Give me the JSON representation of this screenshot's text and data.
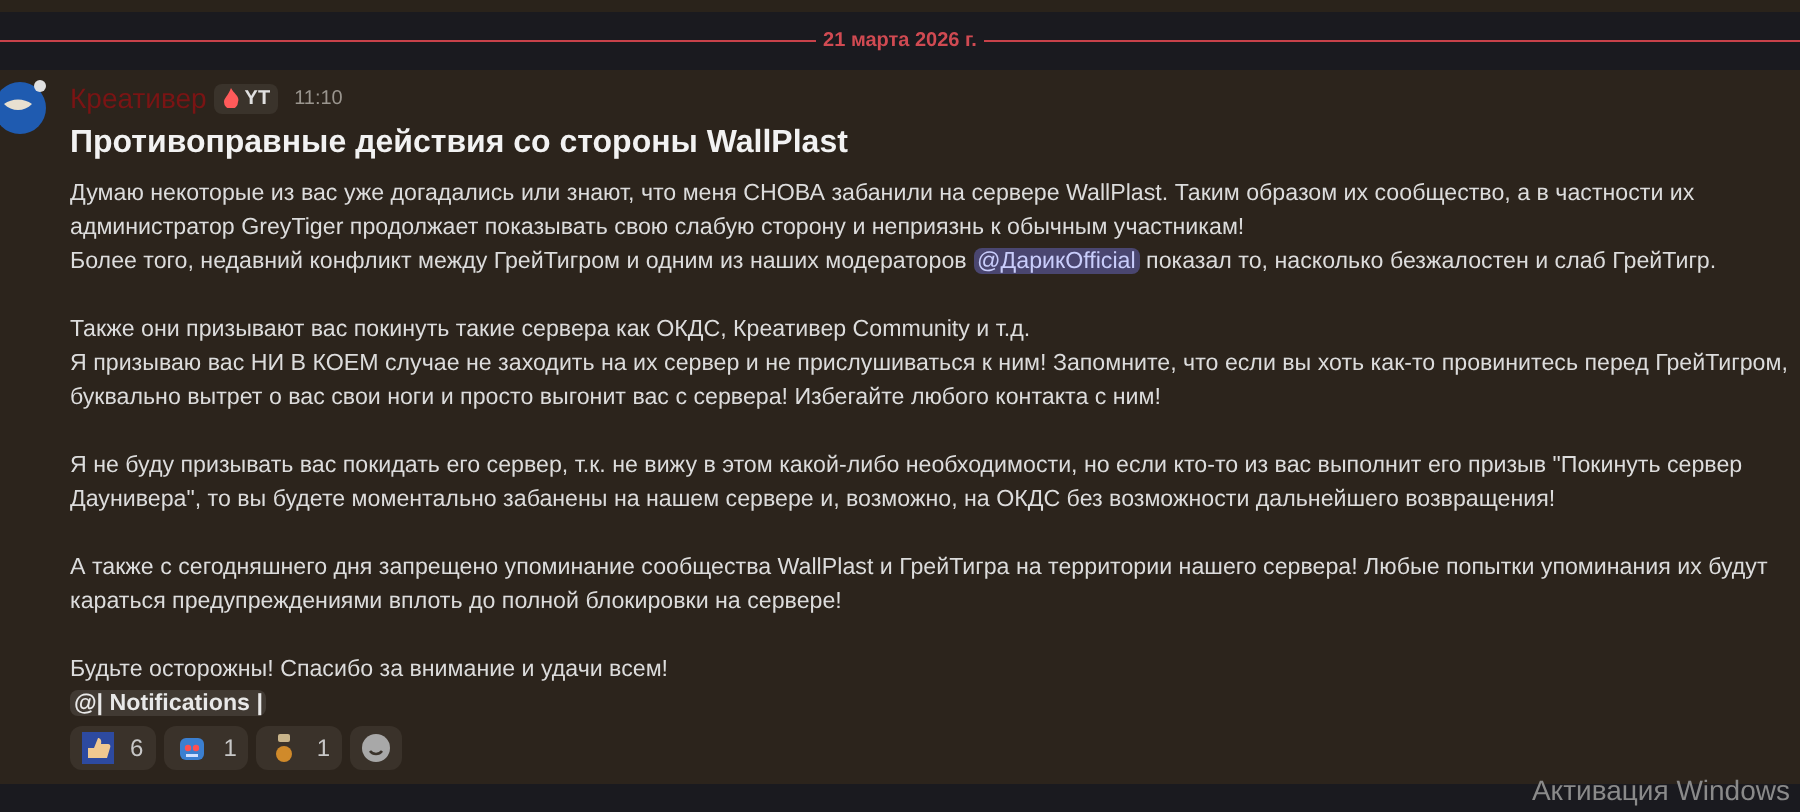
{
  "date_divider": "21 марта 2026 г.",
  "message": {
    "author": "Креативер",
    "tag": "YT",
    "time": "11:10",
    "title": "Противоправные действия со стороны WallPlast",
    "paragraphs": [
      [
        [
          {
            "kind": "text",
            "text": "Думаю некоторые из вас уже догадались или знают, что меня СНОВА забанили на сервере WallPlast. Таким образом их сообщество, а в частности их"
          }
        ],
        [
          {
            "kind": "text",
            "text": "администратор GreyTiger продолжает показывать свою слабую сторону и неприязнь к обычным участникам!"
          }
        ],
        [
          {
            "kind": "text",
            "text": "Более того, недавний конфликт между ГрейТигром и одним из наших модераторов "
          },
          {
            "kind": "mention",
            "text": "@ДарикOfficial"
          },
          {
            "kind": "text",
            "text": " показал то, насколько безжалостен и слаб ГрейТигр."
          }
        ]
      ],
      [
        [
          {
            "kind": "text",
            "text": "Также они призывают вас покинуть такие сервера как ОКДС, Креативер Community и т.д."
          }
        ],
        [
          {
            "kind": "text",
            "text": "Я призываю вас НИ В КОЕМ случае не заходить на их сервер и не прислушиваться к ним! Запомните, что если вы хоть как-то провинитесь перед ГрейТигром,"
          }
        ],
        [
          {
            "kind": "text",
            "text": "буквально вытрет о вас свои ноги и просто выгонит вас с сервера! Избегайте любого контакта с ним!"
          }
        ]
      ],
      [
        [
          {
            "kind": "text",
            "text": "Я не буду призывать вас покидать его сервер, т.к. не вижу в этом какой-либо необходимости, но если кто-то из вас выполнит его призыв \"Покинуть сервер"
          }
        ],
        [
          {
            "kind": "text",
            "text": "Даунивера\", то вы будете моментально забанены на нашем сервере и, возможно, на ОКДС без возможности дальнейшего возвращения!"
          }
        ]
      ],
      [
        [
          {
            "kind": "text",
            "text": "А также с сегодняшнего дня запрещено упоминание сообщества WallPlast и ГрейТигра на территории нашего сервера! Любые попытки упоминания их будут"
          }
        ],
        [
          {
            "kind": "text",
            "text": "караться предупреждениями вплоть до полной блокировки на сервере!"
          }
        ]
      ],
      [
        [
          {
            "kind": "text",
            "text": "Будьте осторожны! Спасибо за внимание и удачи всем!"
          }
        ]
      ]
    ],
    "role_mention": "@| Notifications |",
    "reactions": [
      {
        "kind": "thumbs",
        "count": "6"
      },
      {
        "kind": "robot",
        "count": "1"
      },
      {
        "kind": "figure",
        "count": "1"
      }
    ]
  },
  "os_notice": "Активация Windows"
}
